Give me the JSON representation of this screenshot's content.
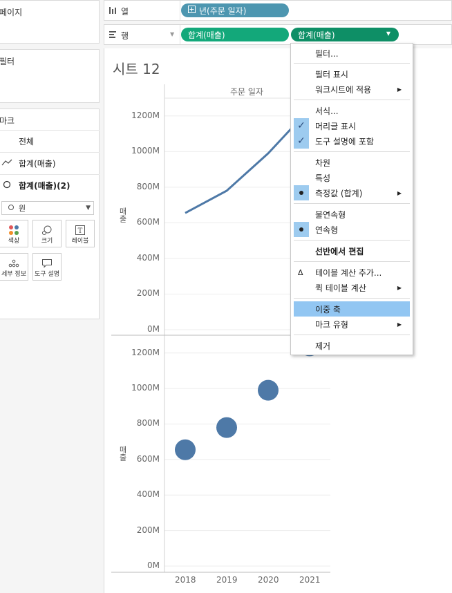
{
  "sidebar": {
    "pages_title": "페이지",
    "filters_title": "필터",
    "marks_title": "마크",
    "marks_all": "전체",
    "marks_line": "합계(매출)",
    "marks_circle": "합계(매출)(2)",
    "mark_type": "원",
    "cards": {
      "color": "색상",
      "size": "크기",
      "label": "레이블",
      "detail": "세부 정보",
      "tooltip": "도구 설명"
    }
  },
  "shelves": {
    "columns_label": "열",
    "rows_label": "행",
    "columns_pill": "년(주문 일자)",
    "rows_pill_1": "합계(매출)",
    "rows_pill_2": "합계(매출)"
  },
  "sheet": {
    "title": "시트 12",
    "column_header": "주문 일자",
    "measure_label": "매출"
  },
  "colors": {
    "mark": "#4e79a7",
    "pill_blue": "#4d96b0",
    "pill_green": "#13a87a",
    "menu_highlight": "#92c6f2"
  },
  "context_menu": {
    "items": {
      "filter": "필터...",
      "show_filter": "필터 표시",
      "apply_worksheets": "워크시트에 적용",
      "format": "서식...",
      "show_header": "머리글 표시",
      "include_tooltip": "도구 설명에 포함",
      "dimension": "차원",
      "attribute": "특성",
      "measure": "측정값 (합계)",
      "discrete": "불연속형",
      "continuous": "연속형",
      "edit_in_shelf": "선반에서 편집",
      "add_table_calc": "테이블 계산 추가...",
      "quick_table_calc": "퀵 테이블 계산",
      "dual_axis": "이중 축",
      "mark_type": "마크 유형",
      "remove": "제거"
    }
  },
  "chart_data": [
    {
      "type": "line",
      "categories": [
        "2018",
        "2019",
        "2020",
        "2021"
      ],
      "values": [
        655,
        780,
        990,
        1240
      ],
      "ylabel": "매출",
      "ylim": [
        0,
        1300
      ],
      "yticks": [
        "0M",
        "200M",
        "400M",
        "600M",
        "800M",
        "1000M",
        "1200M"
      ]
    },
    {
      "type": "scatter",
      "categories": [
        "2018",
        "2019",
        "2020",
        "2021"
      ],
      "values": [
        655,
        780,
        990,
        1240
      ],
      "ylabel": "매출",
      "xlabel": "",
      "ylim": [
        0,
        1300
      ],
      "yticks": [
        "0M",
        "200M",
        "400M",
        "600M",
        "800M",
        "1000M",
        "1200M"
      ],
      "xticks": [
        "2018",
        "2019",
        "2020",
        "2021"
      ]
    }
  ]
}
